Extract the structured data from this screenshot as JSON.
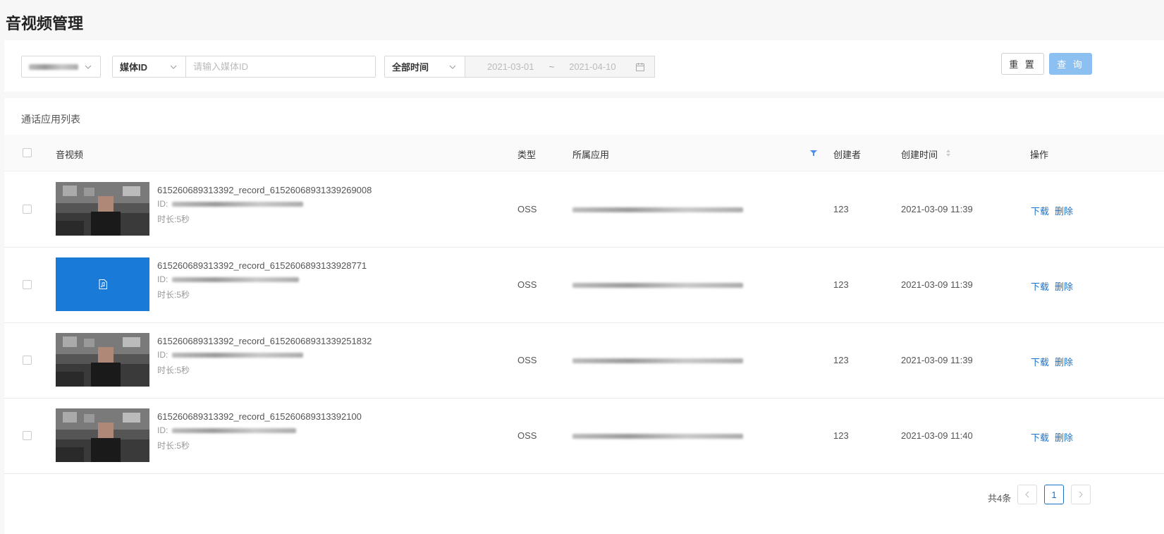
{
  "page": {
    "title": "音视频管理"
  },
  "filters": {
    "media_type_select": "媒体ID",
    "media_input_placeholder": "请输入媒体ID",
    "time_select": "全部时间",
    "date_start": "2021-03-01",
    "date_sep": "~",
    "date_end": "2021-04-10",
    "reset_label": "重 置",
    "query_label": "查 询"
  },
  "list": {
    "title": "通话应用列表",
    "columns": {
      "media": "音视频",
      "type": "类型",
      "app": "所属应用",
      "creator": "创建者",
      "created_at": "创建时间",
      "actions": "操作"
    },
    "id_label": "ID:",
    "duration_label": "时长:",
    "rows": [
      {
        "name": "615260689313392_record_615260689313392690​08",
        "thumb": "video",
        "duration": "5秒",
        "type": "OSS",
        "creator": "123",
        "created_at": "2021-03-09 11:39",
        "download": "下载",
        "delete": "删除"
      },
      {
        "name": "615260689313392_record_6152606893133928771",
        "thumb": "audio",
        "duration": "5秒",
        "type": "OSS",
        "creator": "123",
        "created_at": "2021-03-09 11:39",
        "download": "下载",
        "delete": "删除"
      },
      {
        "name": "615260689313392_record_61526068931339251832",
        "thumb": "video",
        "duration": "5秒",
        "type": "OSS",
        "creator": "123",
        "created_at": "2021-03-09 11:39",
        "download": "下载",
        "delete": "删除"
      },
      {
        "name": "615260689313392_record_615260689313392100",
        "thumb": "video",
        "duration": "5秒",
        "type": "OSS",
        "creator": "123",
        "created_at": "2021-03-09 11:40",
        "download": "下载",
        "delete": "删除"
      }
    ]
  },
  "pagination": {
    "total": "共4条",
    "current": "1"
  },
  "colors": {
    "accent": "#1a73c8",
    "query_button": "#8cc0f0",
    "audio_thumb": "#1a7ad8"
  }
}
